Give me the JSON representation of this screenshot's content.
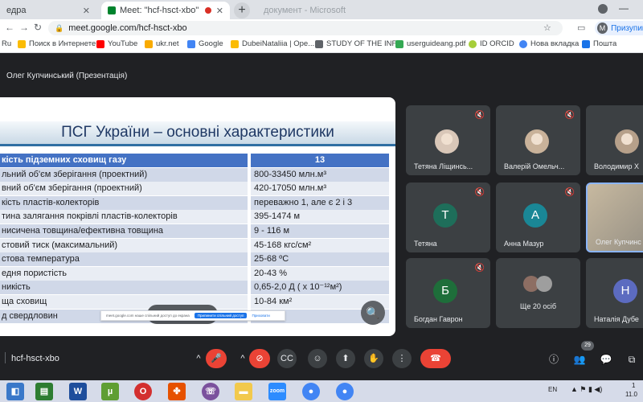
{
  "browser": {
    "tabs": [
      {
        "label": "едра"
      },
      {
        "label": "Meet: \"hcf-hsct-xbo\"",
        "active": true
      },
      {
        "label": "документ - Microsoft Word",
        "faded": true
      }
    ],
    "url": "meet.google.com/hcf-hsct-xbo",
    "profile_label": "Призупине",
    "profile_initial": "M"
  },
  "bookmarks": [
    {
      "label": "Ru",
      "color": "#4285f4"
    },
    {
      "label": "Поиск в Интернете",
      "color": "#fbbc04"
    },
    {
      "label": "YouTube",
      "color": "#ff0000"
    },
    {
      "label": "ukr.net",
      "color": "#f9ab00"
    },
    {
      "label": "Google",
      "color": "#4285f4"
    },
    {
      "label": "DubeiNataliia | Ope...",
      "color": "#fbbc04"
    },
    {
      "label": "STUDY OF THE INF...",
      "color": "#5f6368"
    },
    {
      "label": "userguideang.pdf",
      "color": "#34a853"
    },
    {
      "label": "ID ORCID",
      "color": "#a6ce39"
    },
    {
      "label": "Нова вкладка",
      "color": "#4285f4"
    },
    {
      "label": "Пошта",
      "color": "#1a73e8"
    }
  ],
  "meet": {
    "presenter_title": "Олег Купчинський (Презентація)",
    "meeting_code": "hcf-hsct-xbo",
    "participant_count": "29",
    "notification_text": "meet.google.com наше спільний доступ до екрана",
    "notification_button": "Припинити спільний доступ",
    "notification_link": "Приховати"
  },
  "slide": {
    "title": "ПСГ України – основні характеристики",
    "rows": [
      {
        "label": "кість підземних сховищ газу",
        "value": "13"
      },
      {
        "label": "льний об'єм зберігання (проектний)",
        "value": "800-33450 млн.м³"
      },
      {
        "label": "вний об'єм зберігання (проектний)",
        "value": "420-17050 млн.м³"
      },
      {
        "label": "кість пластів-колекторів",
        "value": "переважно 1, але є 2 і 3"
      },
      {
        "label": "тина залягання покрівлі пластів-колекторів",
        "value": "395-1474 м"
      },
      {
        "label": "нисичена товщина/ефективна товщина",
        "value": "9 - 116 м"
      },
      {
        "label": "стовий тиск  (максимальний)",
        "value": "45-168 кгс/см²"
      },
      {
        "label": "стова температура",
        "value": "25-68 ºС"
      },
      {
        "label": "едня пористість",
        "value": "20-43 %"
      },
      {
        "label": "никість",
        "value": "0,65-2,0 Д ( х 10⁻¹²м²)"
      },
      {
        "label": "ща сховищ",
        "value": "10-84 км²"
      },
      {
        "label": "д свердловин",
        "value": ""
      }
    ]
  },
  "participants": [
    {
      "name": "Тетяна Ліщинсь...",
      "kind": "photo",
      "color": "#d9c7b8"
    },
    {
      "name": "Валерій Омельч...",
      "kind": "photo",
      "color": "#c9b29a"
    },
    {
      "name": "Володимир Х",
      "kind": "photo",
      "color": "#b6a08a"
    },
    {
      "name": "Тетяна",
      "kind": "letter",
      "letter": "T",
      "color": "#1e6e5a"
    },
    {
      "name": "Анна Мазур",
      "kind": "letter",
      "letter": "A",
      "color": "#1a8796"
    },
    {
      "name": "Олег Купчинс",
      "kind": "video",
      "color": "#a99a82"
    },
    {
      "name": "Богдан Гаврон",
      "kind": "letter",
      "letter": "Б",
      "color": "#1e6e3a"
    },
    {
      "name": "Ще 20 осіб",
      "kind": "more",
      "color": "#5f6368"
    },
    {
      "name": "Наталія Дубе",
      "kind": "letter",
      "letter": "Н",
      "color": "#5c6bc0"
    }
  ],
  "taskbar": {
    "lang": "EN",
    "time": "1",
    "date": "11.0"
  }
}
